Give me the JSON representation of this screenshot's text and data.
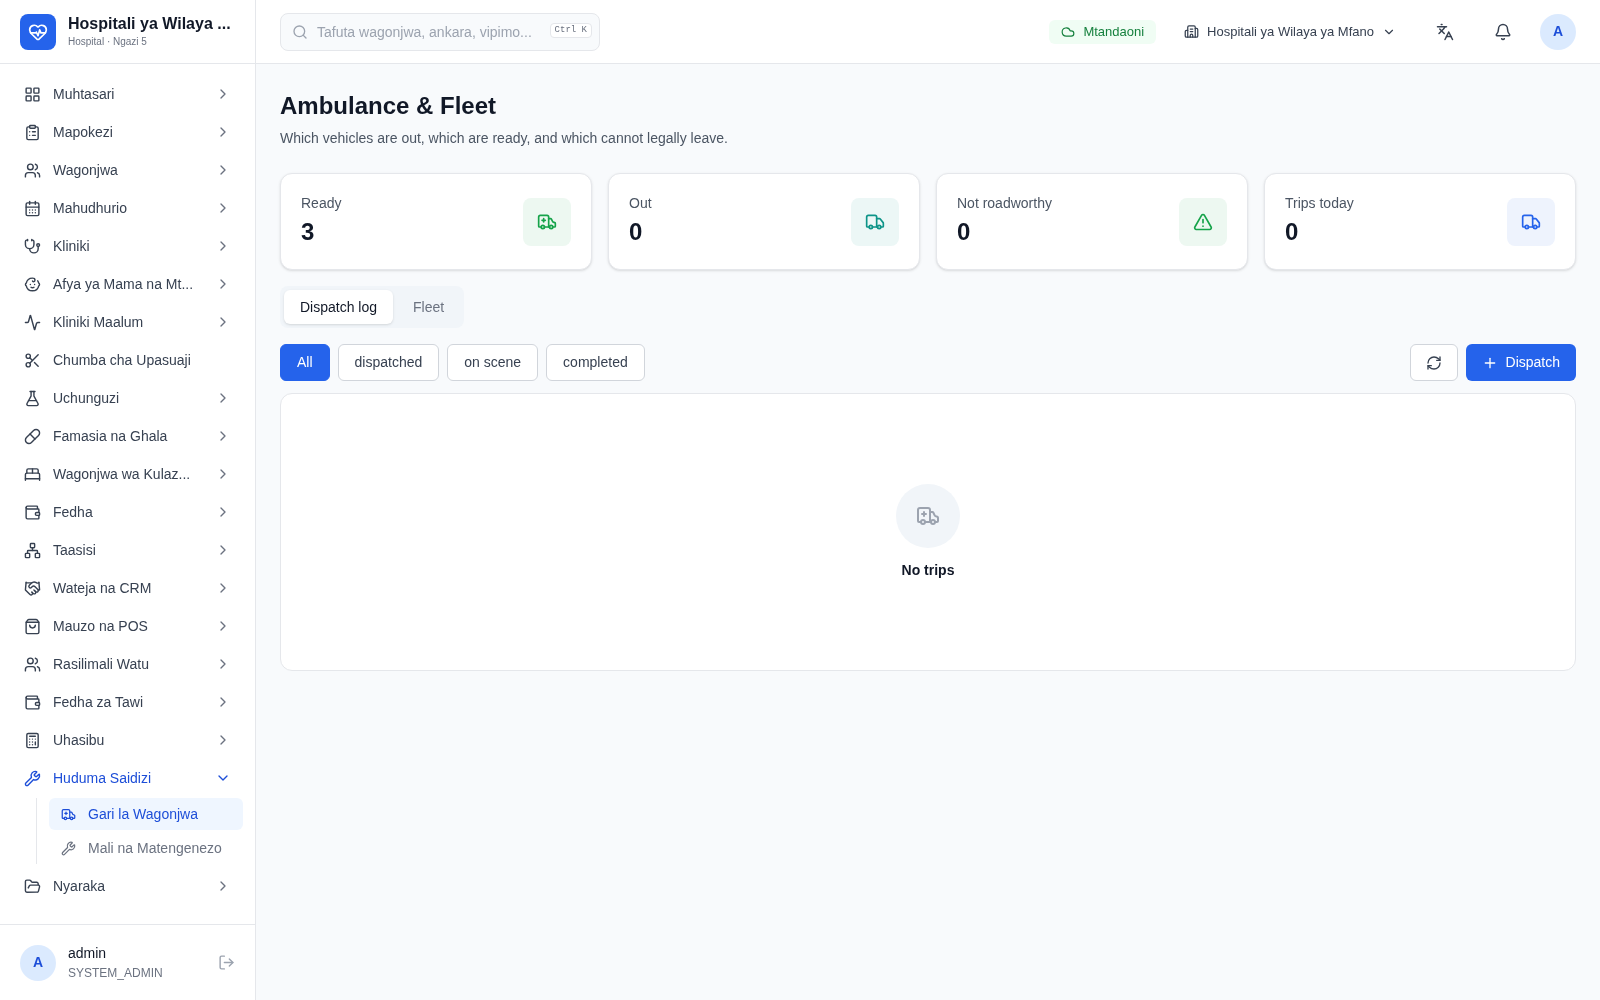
{
  "brand": {
    "name": "Hospitali ya Wilaya ...",
    "subtitle": "Hospital · Ngazi 5"
  },
  "search": {
    "placeholder": "Tafuta wagonjwa, ankara, vipimo...",
    "shortcut": "Ctrl K"
  },
  "header": {
    "status": "Mtandaoni",
    "facility": "Hospitali ya Wilaya ya Mfano",
    "avatar": "A"
  },
  "sidebar": {
    "items": [
      {
        "label": "Muhtasari",
        "has_submenu": true,
        "expanded": false
      },
      {
        "label": "Mapokezi",
        "has_submenu": true,
        "expanded": false
      },
      {
        "label": "Wagonjwa",
        "has_submenu": true,
        "expanded": false
      },
      {
        "label": "Mahudhurio",
        "has_submenu": true,
        "expanded": false
      },
      {
        "label": "Kliniki",
        "has_submenu": true,
        "expanded": false
      },
      {
        "label": "Afya ya Mama na Mt...",
        "has_submenu": true,
        "expanded": false
      },
      {
        "label": "Kliniki Maalum",
        "has_submenu": true,
        "expanded": false
      },
      {
        "label": "Chumba cha Upasuaji",
        "has_submenu": false,
        "expanded": false
      },
      {
        "label": "Uchunguzi",
        "has_submenu": true,
        "expanded": false
      },
      {
        "label": "Famasia na Ghala",
        "has_submenu": true,
        "expanded": false
      },
      {
        "label": "Wagonjwa wa Kulaz...",
        "has_submenu": true,
        "expanded": false
      },
      {
        "label": "Fedha",
        "has_submenu": true,
        "expanded": false
      },
      {
        "label": "Taasisi",
        "has_submenu": true,
        "expanded": false
      },
      {
        "label": "Wateja na CRM",
        "has_submenu": true,
        "expanded": false
      },
      {
        "label": "Mauzo na POS",
        "has_submenu": true,
        "expanded": false
      },
      {
        "label": "Rasilimali Watu",
        "has_submenu": true,
        "expanded": false
      },
      {
        "label": "Fedha za Tawi",
        "has_submenu": true,
        "expanded": false
      },
      {
        "label": "Uhasibu",
        "has_submenu": true,
        "expanded": false
      },
      {
        "label": "Huduma Saidizi",
        "has_submenu": true,
        "expanded": true,
        "children": [
          {
            "label": "Gari la Wagonjwa",
            "selected": true
          },
          {
            "label": "Mali na Matengenezo",
            "selected": false
          }
        ]
      },
      {
        "label": "Nyaraka",
        "has_submenu": true,
        "expanded": false
      }
    ]
  },
  "user": {
    "avatar": "A",
    "name": "admin",
    "role": "SYSTEM_ADMIN"
  },
  "page": {
    "title": "Ambulance & Fleet",
    "subtitle": "Which vehicles are out, which are ready, and which cannot legally leave."
  },
  "stats": [
    {
      "label": "Ready",
      "value": "3",
      "color": "#16a34a"
    },
    {
      "label": "Out",
      "value": "0",
      "color": "#0d9488"
    },
    {
      "label": "Not roadworthy",
      "value": "0",
      "color": "#16a34a"
    },
    {
      "label": "Trips today",
      "value": "0",
      "color": "#2563eb"
    }
  ],
  "tabs": [
    {
      "label": "Dispatch log",
      "selected": true
    },
    {
      "label": "Fleet",
      "selected": false
    }
  ],
  "filters": [
    {
      "label": "All",
      "selected": true
    },
    {
      "label": "dispatched",
      "selected": false
    },
    {
      "label": "on scene",
      "selected": false
    },
    {
      "label": "completed",
      "selected": false
    }
  ],
  "dispatch_button": "Dispatch",
  "empty": {
    "text": "No trips"
  }
}
